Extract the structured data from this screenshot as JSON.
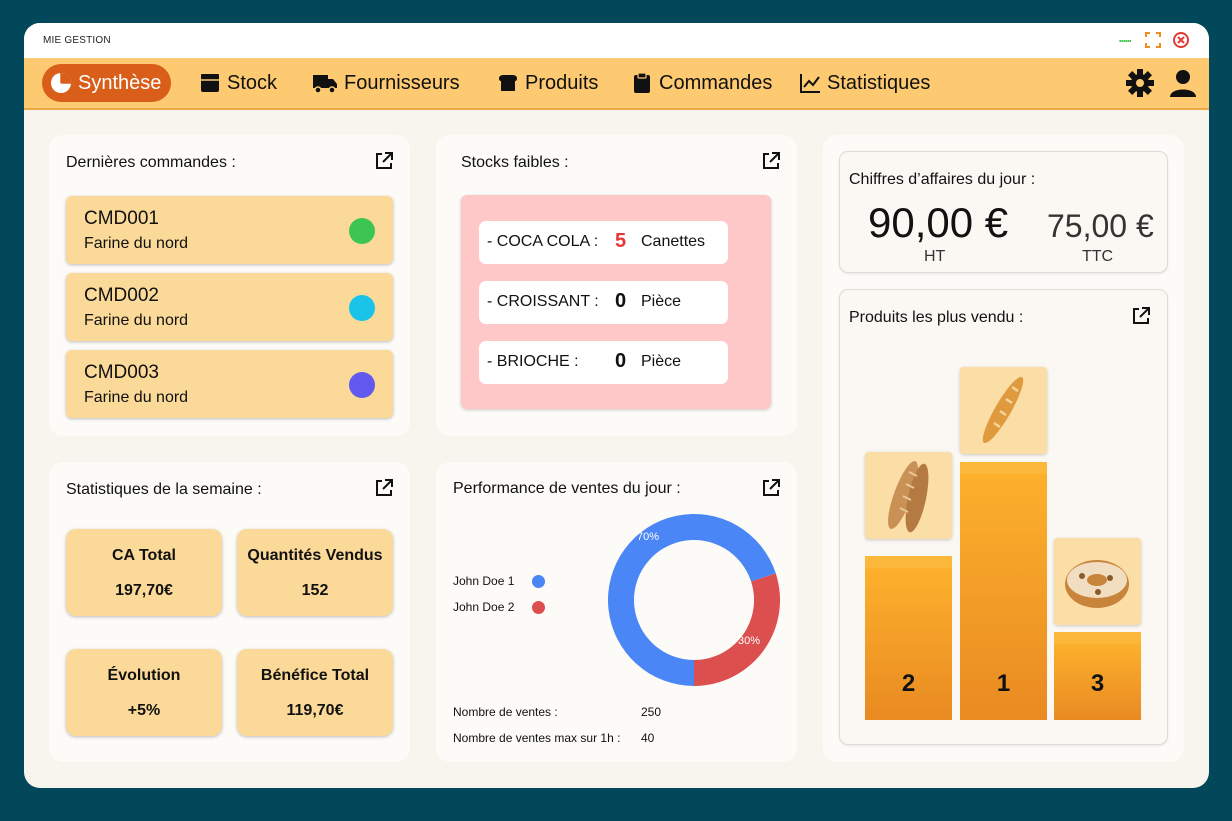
{
  "app": {
    "title": "MIE GESTION"
  },
  "nav": {
    "items": [
      {
        "label": "Synthèse"
      },
      {
        "label": "Stock"
      },
      {
        "label": "Fournisseurs"
      },
      {
        "label": "Produits"
      },
      {
        "label": "Commandes"
      },
      {
        "label": "Statistiques"
      }
    ],
    "active_index": 0
  },
  "orders": {
    "title": "Dernières commandes :",
    "items": [
      {
        "code": "CMD001",
        "supplier": "Farine du nord",
        "status_color": "#3cc552"
      },
      {
        "code": "CMD002",
        "supplier": "Farine du nord",
        "status_color": "#1ac4e8"
      },
      {
        "code": "CMD003",
        "supplier": "Farine du nord",
        "status_color": "#6259ef"
      }
    ]
  },
  "stocks": {
    "title": "Stocks faibles :",
    "items": [
      {
        "name": "- COCA COLA :",
        "qty": "5",
        "unit": "Canettes",
        "qty_color": "#e53935"
      },
      {
        "name": "- CROISSANT :",
        "qty": "0",
        "unit": "Pièce",
        "qty_color": "#111111"
      },
      {
        "name": "- BRIOCHE :",
        "qty": "0",
        "unit": "Pièce",
        "qty_color": "#111111"
      }
    ]
  },
  "weekly": {
    "title": "Statistiques de la semaine :",
    "stats": [
      {
        "label": "CA Total",
        "value": "197,70€"
      },
      {
        "label": "Quantités Vendus",
        "value": "152"
      },
      {
        "label": "Évolution",
        "value": "+5%"
      },
      {
        "label": "Bénéfice Total",
        "value": "119,70€"
      }
    ]
  },
  "performance": {
    "title": "Performance de ventes du jour :",
    "sales_label": "Nombre de ventes :",
    "sales_value": "250",
    "max_label": "Nombre de ventes max sur 1h :",
    "max_value": "40"
  },
  "revenue": {
    "title": "Chiffres d’affaires du jour :",
    "ht_value": "90,00 €",
    "ht_label": "HT",
    "ttc_value": "75,00 €",
    "ttc_label": "TTC"
  },
  "top_products": {
    "title": "Produits les plus vendu :",
    "ranks": [
      "2",
      "1",
      "3"
    ]
  },
  "colors": {
    "accent": "#d85e1a",
    "navbar": "#fdc971",
    "card_yellow": "#fbd999",
    "stock_pink": "#ffc8c8"
  },
  "chart_data": {
    "type": "pie",
    "variant": "donut",
    "series": [
      {
        "name": "John Doe 1",
        "value": 70,
        "label": "70%",
        "color": "#4a86f5"
      },
      {
        "name": "John Doe 2",
        "value": 30,
        "label": "30%",
        "color": "#dc4f4f"
      }
    ],
    "legend_position": "left"
  }
}
